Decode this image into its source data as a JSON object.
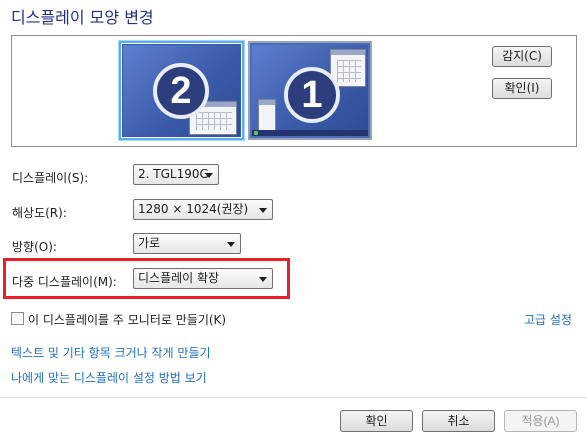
{
  "title": "디스플레이 모양 변경",
  "preview": {
    "monitors": [
      {
        "number": "2",
        "selected": true
      },
      {
        "number": "1",
        "selected": false
      }
    ],
    "detect_label": "감지(C)",
    "identify_label": "확인(I)"
  },
  "settings": {
    "display_label": "디스플레이(S):",
    "display_value": "2. TGL190G",
    "resolution_label": "해상도(R):",
    "resolution_value": "1280 × 1024(권장)",
    "orientation_label": "방향(O):",
    "orientation_value": "가로",
    "multi_display_label": "다중 디스플레이(M):",
    "multi_display_value": "디스플레이 확장"
  },
  "main_display_checkbox_label": "이 디스플레이를 주 모니터로 만들기(K)",
  "links": {
    "advanced": "고급 설정",
    "text_size": "텍스트 및 기타 항목 크거나 작게 만들기",
    "which_settings": "나에게 맞는 디스플레이 설정 방법 보기"
  },
  "buttons": {
    "ok": "확인",
    "cancel": "취소",
    "apply": "적용(A)"
  },
  "colors": {
    "title": "#1e3287",
    "link": "#1e6ec8",
    "highlight": "#e8202a"
  }
}
